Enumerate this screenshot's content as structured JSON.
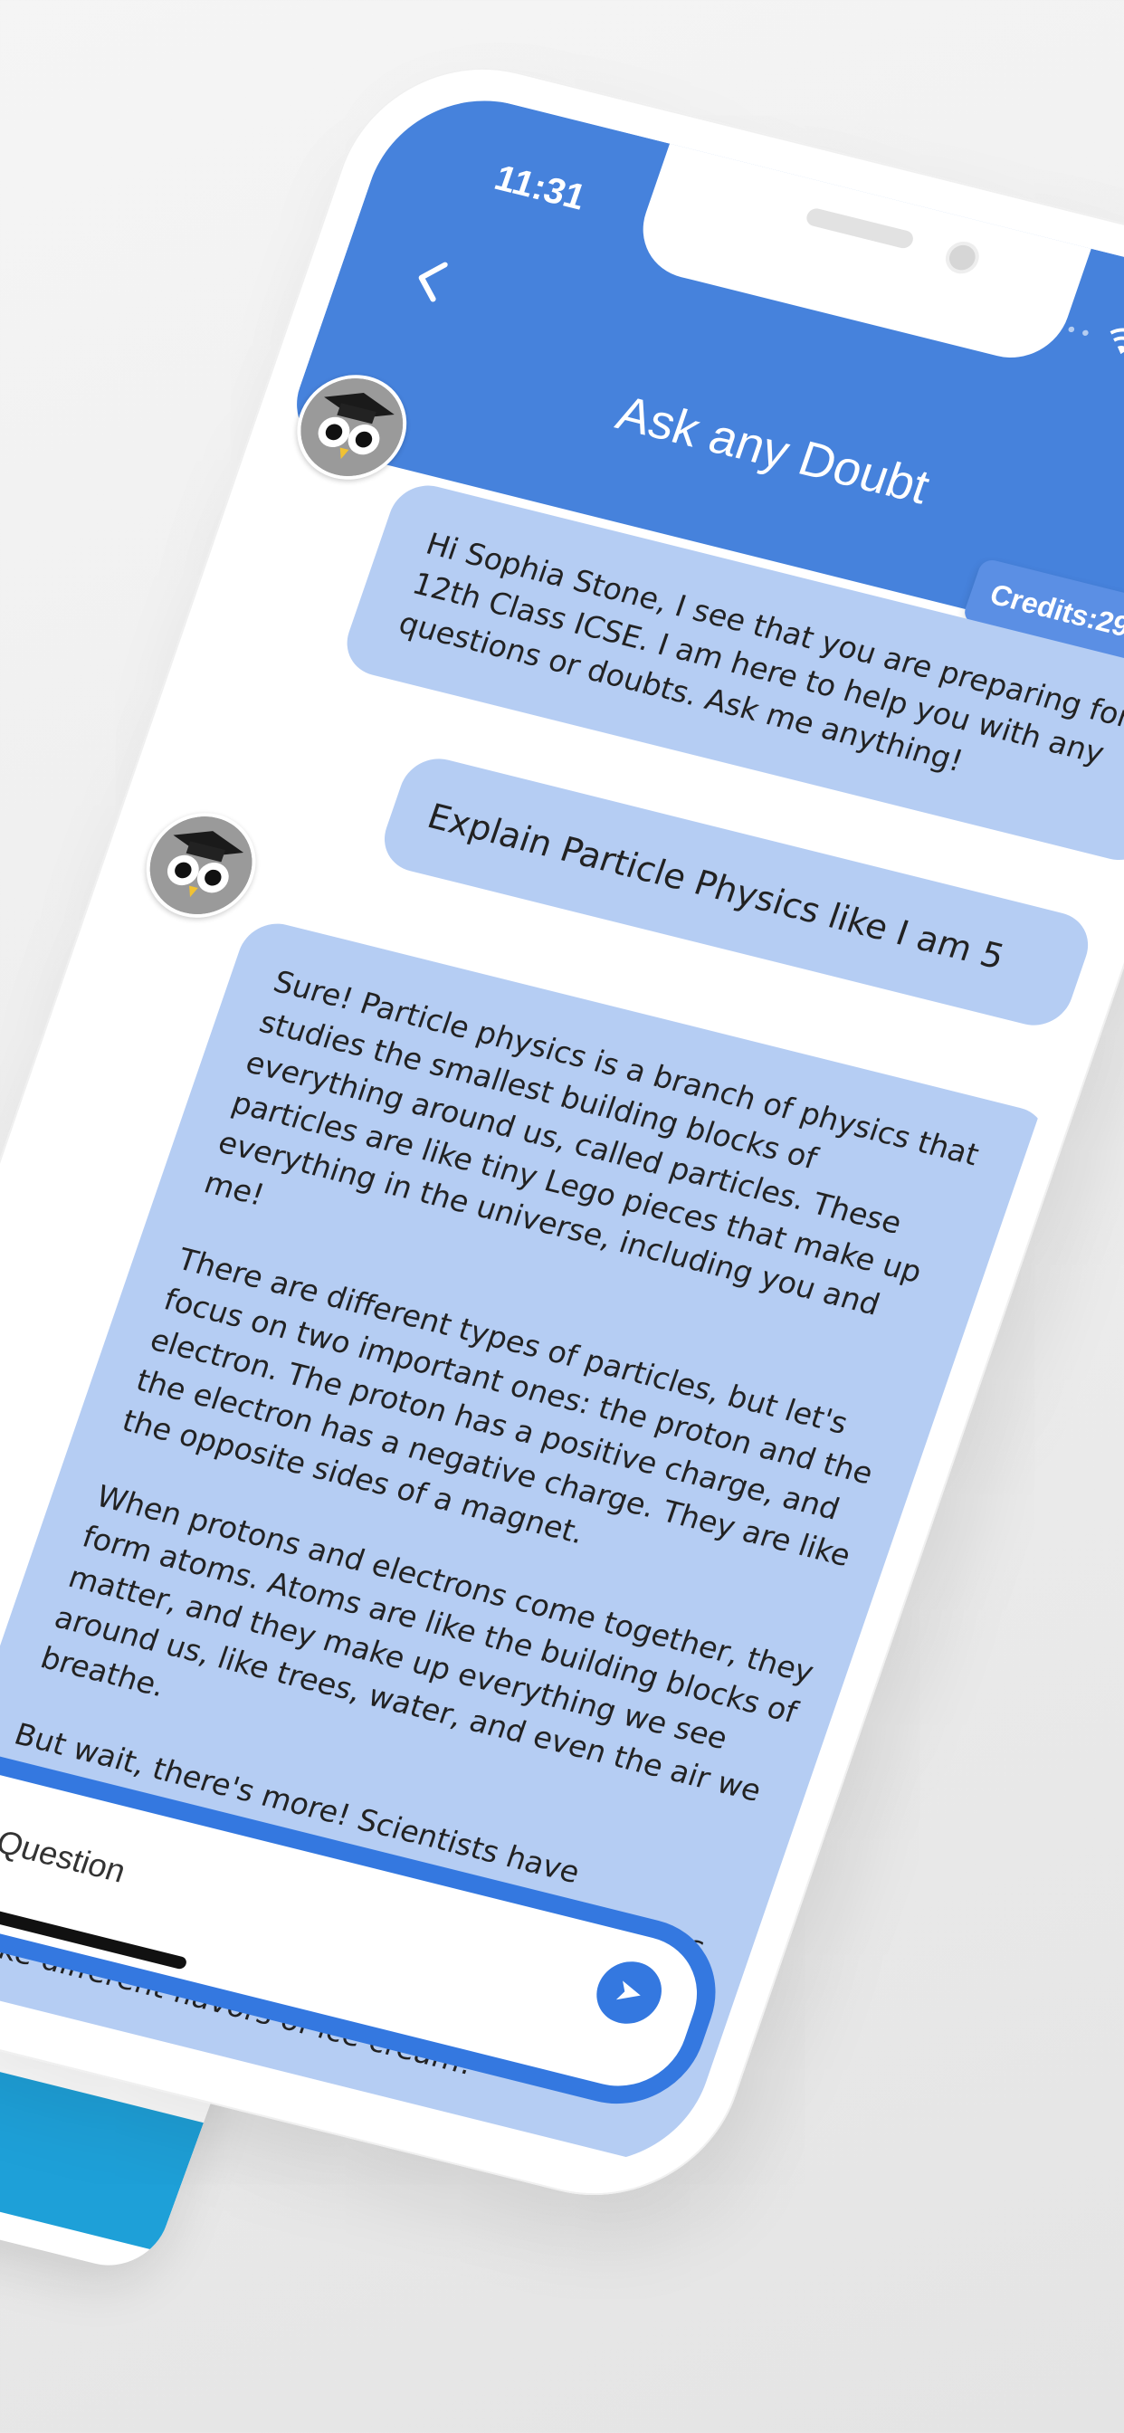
{
  "status_bar": {
    "time": "11:31"
  },
  "header": {
    "title": "Ask any Doubt",
    "credits": "Credits:29",
    "back_icon": "chevron-left-icon"
  },
  "messages": [
    {
      "from": "bot",
      "text": "Hi Sophia Stone, I see that you are preparing for 12th Class ICSE. I am here to help you with any questions or doubts. Ask me anything!"
    },
    {
      "from": "user",
      "text": "Explain Particle Physics like I am 5"
    },
    {
      "from": "bot",
      "paragraphs": [
        "Sure! Particle physics is a branch of physics that studies the smallest building blocks of everything around us, called particles. These particles are like tiny Lego pieces that make up everything in the universe, including you and me!",
        "There are different types of particles, but let's focus on two important ones: the proton and the electron. The proton has a positive charge, and the electron has a negative charge. They are like the opposite sides of a magnet.",
        "When protons and electrons come together, they form atoms. Atoms are like the building blocks of matter, and they make up everything we see around us, like trees, water, and even the air we breathe.",
        "But wait, there's more! Scientists have discovered even smaller particles inside protons and electrons. These particles are called quarks. Quarks come in different flavors, like up, down, charm, strange, top, and bottom. They are kind of like different flavors of ice cream!"
      ]
    }
  ],
  "input": {
    "placeholder": "Type your Question"
  },
  "colors": {
    "primary": "#4682dc",
    "bubble": "#b5cdf3",
    "input_border": "#3478e0"
  }
}
